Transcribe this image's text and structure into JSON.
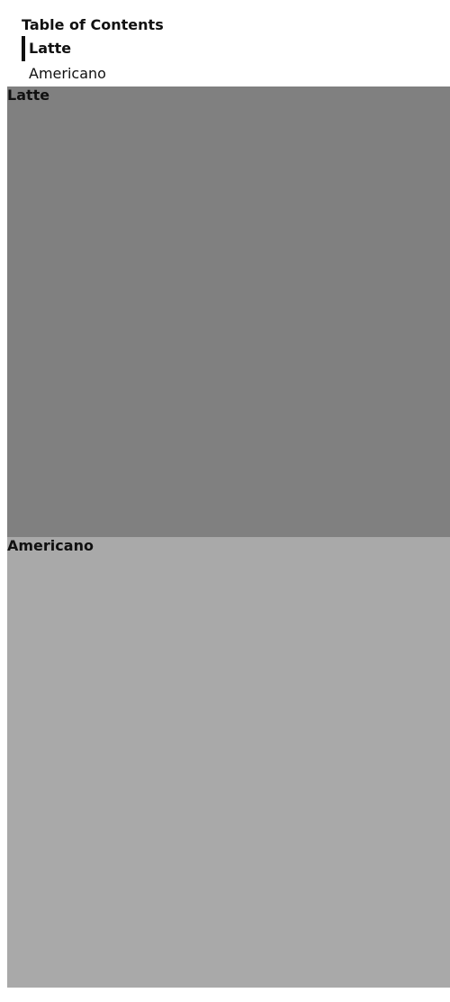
{
  "toc": {
    "title": "Table of Contents",
    "items": [
      {
        "label": "Latte",
        "active": true
      },
      {
        "label": "Americano",
        "active": false
      }
    ]
  },
  "sections": [
    {
      "heading": "Latte",
      "color": "#808080"
    },
    {
      "heading": "Americano",
      "color": "#a9a9a9"
    }
  ]
}
